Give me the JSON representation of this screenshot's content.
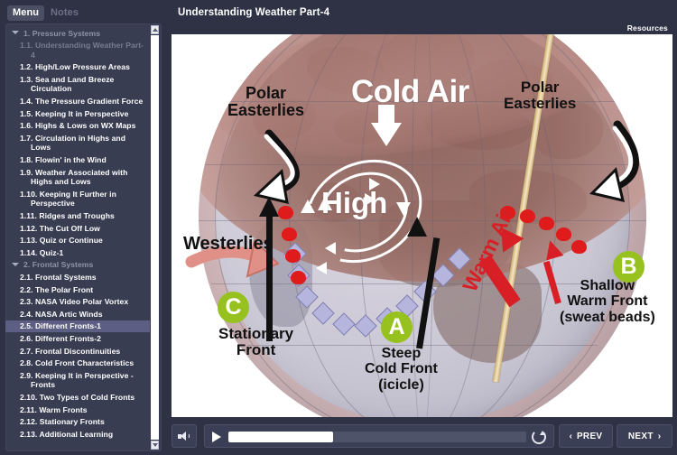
{
  "window": {
    "bg_color": "#2e3244"
  },
  "sidebar": {
    "tabs": [
      {
        "label": "Menu",
        "active": true
      },
      {
        "label": "Notes",
        "active": false
      }
    ],
    "selected_item": "2.5. Different Fronts-1",
    "items": [
      {
        "label": "1. Pressure Systems",
        "level": 1,
        "state": "section"
      },
      {
        "label": "1.1. Understanding Weather Part-4",
        "level": 2,
        "state": "visited"
      },
      {
        "label": "1.2. High/Low Pressure Areas",
        "level": 2,
        "state": "normal"
      },
      {
        "label": "1.3.  Sea and Land Breeze Circulation",
        "level": 2,
        "state": "normal"
      },
      {
        "label": "1.4. The Pressure Gradient Force",
        "level": 2,
        "state": "normal"
      },
      {
        "label": "1.5. Keeping It in Perspective",
        "level": 2,
        "state": "normal"
      },
      {
        "label": "1.6. Highs & Lows on WX Maps",
        "level": 2,
        "state": "normal"
      },
      {
        "label": "1.7. Circulation in Highs and Lows",
        "level": 2,
        "state": "normal"
      },
      {
        "label": "1.8. Flowin' in the Wind",
        "level": 2,
        "state": "normal"
      },
      {
        "label": "1.9. Weather Associated with Highs and Lows",
        "level": 2,
        "state": "normal"
      },
      {
        "label": "1.10. Keeping It Further in Perspective",
        "level": 2,
        "state": "normal"
      },
      {
        "label": "1.11. Ridges and Troughs",
        "level": 2,
        "state": "normal"
      },
      {
        "label": "1.12. The Cut Off Low",
        "level": 2,
        "state": "normal"
      },
      {
        "label": "1.13. Quiz or Continue",
        "level": 2,
        "state": "normal"
      },
      {
        "label": "1.14. Quiz-1",
        "level": 2,
        "state": "normal"
      },
      {
        "label": "2. Frontal Systems",
        "level": 1,
        "state": "section"
      },
      {
        "label": "2.1. Frontal Systems",
        "level": 2,
        "state": "normal"
      },
      {
        "label": "2.2. The Polar Front",
        "level": 2,
        "state": "normal"
      },
      {
        "label": "2.3. NASA Video Polar Vortex",
        "level": 2,
        "state": "normal"
      },
      {
        "label": "2.4. NASA Artic Winds",
        "level": 2,
        "state": "normal"
      },
      {
        "label": "2.5. Different Fronts-1",
        "level": 2,
        "state": "selected"
      },
      {
        "label": "2.6. Different Fronts-2",
        "level": 2,
        "state": "normal"
      },
      {
        "label": "2.7. Frontal Discontinuities",
        "level": 2,
        "state": "normal"
      },
      {
        "label": "2.8. Cold Front Characteristics",
        "level": 2,
        "state": "normal"
      },
      {
        "label": "2.9. Keeping It in Perspective - Fronts",
        "level": 2,
        "state": "normal"
      },
      {
        "label": "2.10. Two Types of Cold Fronts",
        "level": 2,
        "state": "normal"
      },
      {
        "label": "2.11. Warm Fronts",
        "level": 2,
        "state": "normal"
      },
      {
        "label": "2.12. Stationary Fronts",
        "level": 2,
        "state": "normal"
      },
      {
        "label": "2.13. Additional Learning",
        "level": 2,
        "state": "normal"
      }
    ],
    "scrollbar": {
      "up_icon": "scroll-up-icon",
      "down_icon": "scroll-down-icon"
    }
  },
  "header": {
    "title": "Understanding Weather Part-4",
    "resources_label": "Resources"
  },
  "slide": {
    "labels": {
      "cold_air": "Cold Air",
      "polar_easterlies_left": "Polar Easterlies",
      "polar_easterlies_right": "Polar Easterlies",
      "high": "High",
      "westerlies": "Westerlies",
      "stationary_front": "Stationary Front",
      "steep_cold_front": "Steep Cold Front (icicle)",
      "warm_air": "Warm Air",
      "shallow_warm_front": "Shallow Warm Front (sweat beads)"
    },
    "multiline": {
      "polar_easterlies_left_l1": "Polar",
      "polar_easterlies_left_l2": "Easterlies",
      "polar_easterlies_right_l1": "Polar",
      "polar_easterlies_right_l2": "Easterlies",
      "stationary_front_l1": "Stationary",
      "stationary_front_l2": "Front",
      "steep_cold_front_l1": "Steep",
      "steep_cold_front_l2": "Cold Front",
      "steep_cold_front_l3": "(icicle)",
      "shallow_warm_front_l1": "Shallow",
      "shallow_warm_front_l2": "Warm Front",
      "shallow_warm_front_l3": "(sweat beads)"
    },
    "badges": [
      {
        "letter": "A",
        "meaning": "Steep Cold Front (icicle)"
      },
      {
        "letter": "B",
        "meaning": "Shallow Warm Front (sweat beads)"
      },
      {
        "letter": "C",
        "meaning": "Stationary Front"
      }
    ],
    "colors": {
      "badge_green": "#96c11e",
      "warm_red": "#d81f26",
      "cold_front_blue": "#b6b5dd",
      "cold_air_brown": "#8c6058"
    }
  },
  "controls": {
    "volume_icon": "speaker-icon",
    "play_icon": "play-icon",
    "replay_icon": "replay-icon",
    "progress_percent": "35",
    "prev_label": "PREV",
    "next_label": "NEXT",
    "prev_chevron": "‹",
    "next_chevron": "›"
  }
}
